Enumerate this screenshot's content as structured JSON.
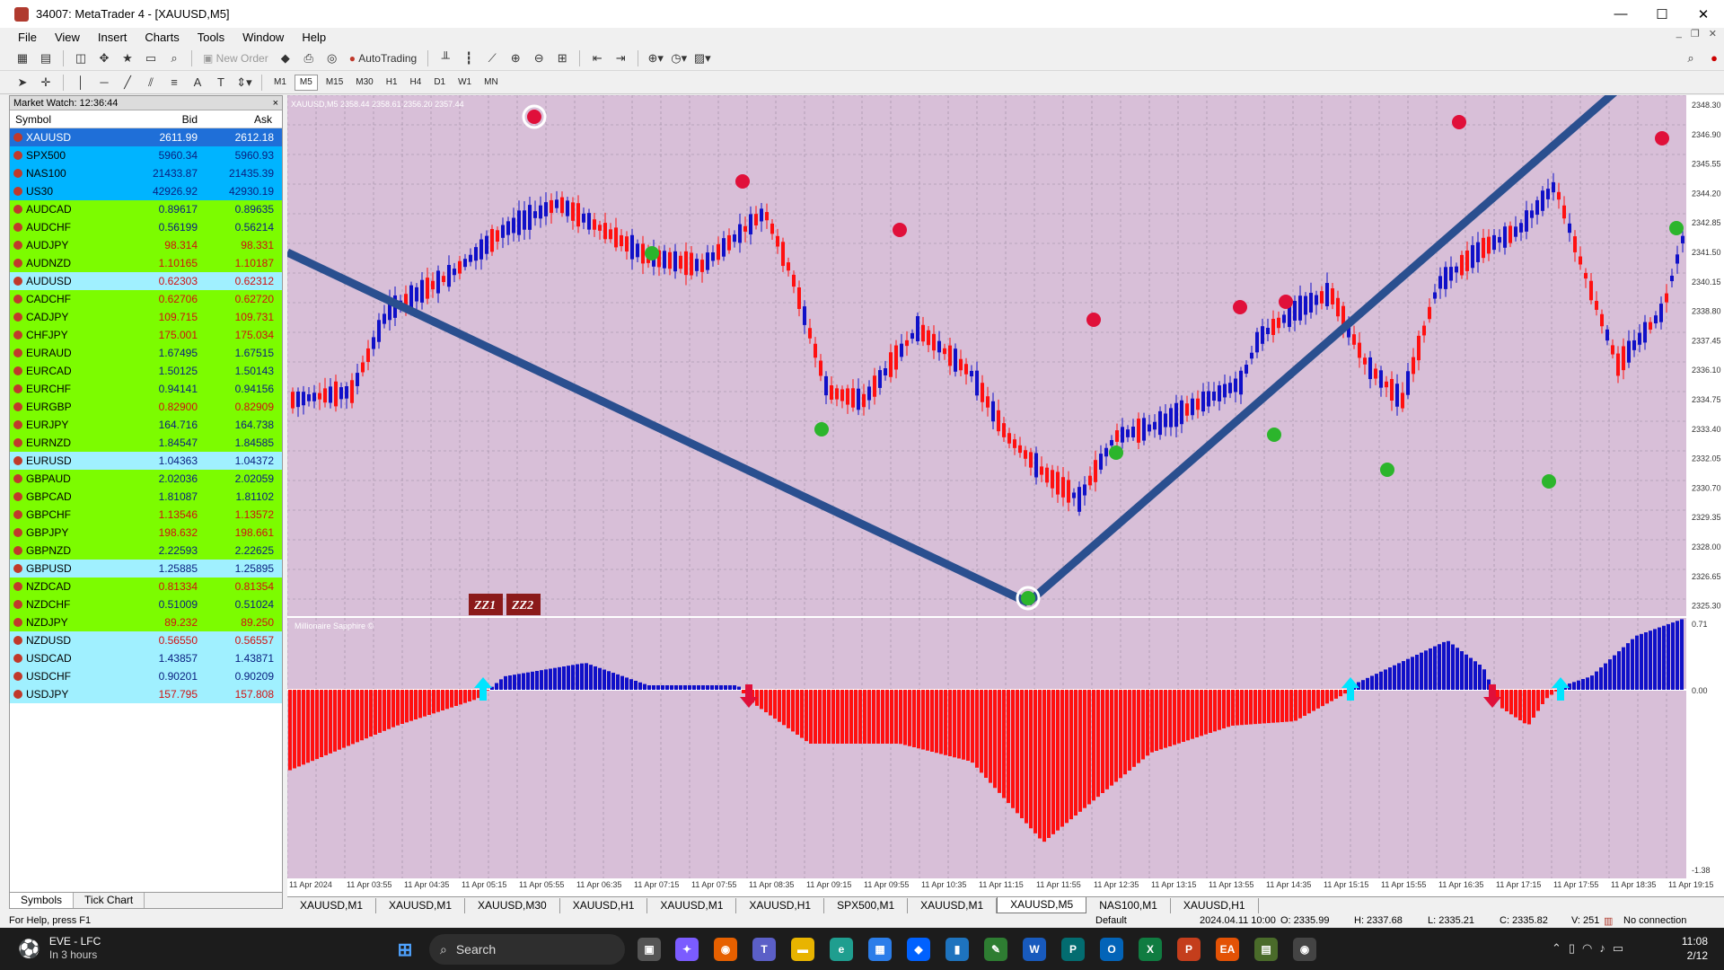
{
  "window": {
    "title": "34007: MetaTrader 4 - [XAUUSD,M5]",
    "minimize": "—",
    "maximize": "☐",
    "close": "✕"
  },
  "menu": [
    "File",
    "View",
    "Insert",
    "Charts",
    "Tools",
    "Window",
    "Help"
  ],
  "toolbar": {
    "new_order": "New Order",
    "autotrading": "AutoTrading"
  },
  "timeframes": [
    "M1",
    "M5",
    "M15",
    "M30",
    "H1",
    "H4",
    "D1",
    "W1",
    "MN"
  ],
  "market_watch": {
    "title": "Market Watch: 12:36:44",
    "close_glyph": "×",
    "columns": [
      "Symbol",
      "Bid",
      "Ask"
    ],
    "rows": [
      {
        "symbol": "XAUUSD",
        "bid": "2611.99",
        "ask": "2612.18",
        "bg": "#1f6fd8",
        "fg": "#ffffff"
      },
      {
        "symbol": "SPX500",
        "bid": "5960.34",
        "ask": "5960.93",
        "bg": "#00b4ff",
        "fg": "#0a2080"
      },
      {
        "symbol": "NAS100",
        "bid": "21433.87",
        "ask": "21435.39",
        "bg": "#00b4ff",
        "fg": "#0a2080"
      },
      {
        "symbol": "US30",
        "bid": "42926.92",
        "ask": "42930.19",
        "bg": "#00b4ff",
        "fg": "#0a2080"
      },
      {
        "symbol": "AUDCAD",
        "bid": "0.89617",
        "ask": "0.89635",
        "bg": "#7cfc00",
        "fg": "#0a2080"
      },
      {
        "symbol": "AUDCHF",
        "bid": "0.56199",
        "ask": "0.56214",
        "bg": "#7cfc00",
        "fg": "#0a2080"
      },
      {
        "symbol": "AUDJPY",
        "bid": "98.314",
        "ask": "98.331",
        "bg": "#7cfc00",
        "fg": "#d01010"
      },
      {
        "symbol": "AUDNZD",
        "bid": "1.10165",
        "ask": "1.10187",
        "bg": "#7cfc00",
        "fg": "#d01010"
      },
      {
        "symbol": "AUDUSD",
        "bid": "0.62303",
        "ask": "0.62312",
        "bg": "#a0f0ff",
        "fg": "#d01010"
      },
      {
        "symbol": "CADCHF",
        "bid": "0.62706",
        "ask": "0.62720",
        "bg": "#7cfc00",
        "fg": "#d01010"
      },
      {
        "symbol": "CADJPY",
        "bid": "109.715",
        "ask": "109.731",
        "bg": "#7cfc00",
        "fg": "#d01010"
      },
      {
        "symbol": "CHFJPY",
        "bid": "175.001",
        "ask": "175.034",
        "bg": "#7cfc00",
        "fg": "#d01010"
      },
      {
        "symbol": "EURAUD",
        "bid": "1.67495",
        "ask": "1.67515",
        "bg": "#7cfc00",
        "fg": "#0a2080"
      },
      {
        "symbol": "EURCAD",
        "bid": "1.50125",
        "ask": "1.50143",
        "bg": "#7cfc00",
        "fg": "#0a2080"
      },
      {
        "symbol": "EURCHF",
        "bid": "0.94141",
        "ask": "0.94156",
        "bg": "#7cfc00",
        "fg": "#0a2080"
      },
      {
        "symbol": "EURGBP",
        "bid": "0.82900",
        "ask": "0.82909",
        "bg": "#7cfc00",
        "fg": "#d01010"
      },
      {
        "symbol": "EURJPY",
        "bid": "164.716",
        "ask": "164.738",
        "bg": "#7cfc00",
        "fg": "#0a2080"
      },
      {
        "symbol": "EURNZD",
        "bid": "1.84547",
        "ask": "1.84585",
        "bg": "#7cfc00",
        "fg": "#0a2080"
      },
      {
        "symbol": "EURUSD",
        "bid": "1.04363",
        "ask": "1.04372",
        "bg": "#a0f0ff",
        "fg": "#0a2080"
      },
      {
        "symbol": "GBPAUD",
        "bid": "2.02036",
        "ask": "2.02059",
        "bg": "#7cfc00",
        "fg": "#0a2080"
      },
      {
        "symbol": "GBPCAD",
        "bid": "1.81087",
        "ask": "1.81102",
        "bg": "#7cfc00",
        "fg": "#0a2080"
      },
      {
        "symbol": "GBPCHF",
        "bid": "1.13546",
        "ask": "1.13572",
        "bg": "#7cfc00",
        "fg": "#d01010"
      },
      {
        "symbol": "GBPJPY",
        "bid": "198.632",
        "ask": "198.661",
        "bg": "#7cfc00",
        "fg": "#d01010"
      },
      {
        "symbol": "GBPNZD",
        "bid": "2.22593",
        "ask": "2.22625",
        "bg": "#7cfc00",
        "fg": "#0a2080"
      },
      {
        "symbol": "GBPUSD",
        "bid": "1.25885",
        "ask": "1.25895",
        "bg": "#a0f0ff",
        "fg": "#0a2080"
      },
      {
        "symbol": "NZDCAD",
        "bid": "0.81334",
        "ask": "0.81354",
        "bg": "#7cfc00",
        "fg": "#d01010"
      },
      {
        "symbol": "NZDCHF",
        "bid": "0.51009",
        "ask": "0.51024",
        "bg": "#7cfc00",
        "fg": "#0a2080"
      },
      {
        "symbol": "NZDJPY",
        "bid": "89.232",
        "ask": "89.250",
        "bg": "#7cfc00",
        "fg": "#d01010"
      },
      {
        "symbol": "NZDUSD",
        "bid": "0.56550",
        "ask": "0.56557",
        "bg": "#a0f0ff",
        "fg": "#d01010"
      },
      {
        "symbol": "USDCAD",
        "bid": "1.43857",
        "ask": "1.43871",
        "bg": "#a0f0ff",
        "fg": "#0a2080"
      },
      {
        "symbol": "USDCHF",
        "bid": "0.90201",
        "ask": "0.90209",
        "bg": "#a0f0ff",
        "fg": "#0a2080"
      },
      {
        "symbol": "USDJPY",
        "bid": "157.795",
        "ask": "157.808",
        "bg": "#a0f0ff",
        "fg": "#d01010"
      }
    ],
    "tabs": [
      "Symbols",
      "Tick Chart"
    ]
  },
  "chart": {
    "header": "XAUUSD,M5  2358.44 2358.61 2356.20 2357.44",
    "indicator_label": "Millionaire Sapphire ©",
    "zz_buttons": [
      "ZZ1",
      "ZZ2"
    ],
    "price_ticks": [
      "2348.30",
      "2346.90",
      "2345.55",
      "2344.20",
      "2342.85",
      "2341.50",
      "2340.15",
      "2338.80",
      "2337.45",
      "2336.10",
      "2334.75",
      "2333.40",
      "2332.05",
      "2330.70",
      "2329.35",
      "2328.00",
      "2326.65",
      "2325.30"
    ],
    "osc_ticks": [
      "0.71",
      "0.00",
      "-1.38"
    ],
    "time_ticks": [
      "11 Apr 2024",
      "11 Apr 03:55",
      "11 Apr 04:35",
      "11 Apr 05:15",
      "11 Apr 05:55",
      "11 Apr 06:35",
      "11 Apr 07:15",
      "11 Apr 07:55",
      "11 Apr 08:35",
      "11 Apr 09:15",
      "11 Apr 09:55",
      "11 Apr 10:35",
      "11 Apr 11:15",
      "11 Apr 11:55",
      "11 Apr 12:35",
      "11 Apr 13:15",
      "11 Apr 13:55",
      "11 Apr 14:35",
      "11 Apr 15:15",
      "11 Apr 15:55",
      "11 Apr 16:35",
      "11 Apr 17:15",
      "11 Apr 17:55",
      "11 Apr 18:35",
      "11 Apr 19:15"
    ],
    "colors": {
      "background": "#d8bfd8",
      "bull": "#1010c8",
      "bear": "#ff1010",
      "trendline": "#2a4f8f",
      "grid": "#9a8aa0"
    }
  },
  "chart_tabs": [
    "XAUUSD,M1",
    "XAUUSD,M1",
    "XAUUSD,M30",
    "XAUUSD,H1",
    "XAUUSD,M1",
    "XAUUSD,H1",
    "SPX500,M1",
    "XAUUSD,M1",
    "XAUUSD,M5",
    "NAS100,M1",
    "XAUUSD,H1"
  ],
  "status": {
    "help": "For Help, press F1",
    "profile": "Default",
    "datetime": "2024.04.11 10:00",
    "open": "O: 2335.99",
    "high": "H: 2337.68",
    "low": "L: 2335.21",
    "close": "C: 2335.82",
    "volume": "V: 251",
    "connection": "No connection"
  },
  "taskbar": {
    "weather_title": "EVE - LFC",
    "weather_sub": "In 3 hours",
    "search": "Search",
    "time": "11:08",
    "date": "2/12"
  }
}
